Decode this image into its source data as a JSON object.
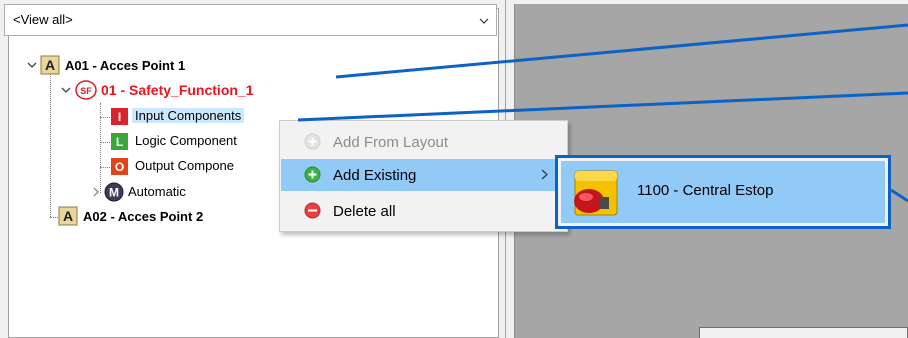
{
  "view_selector": {
    "value": "<View all>"
  },
  "tree": {
    "access_point_1": {
      "badge": "A",
      "label": "A01 - Acces Point 1"
    },
    "safety_function": {
      "badge": "SF",
      "label": "01 - Safety_Function_1"
    },
    "input_components": {
      "badge": "I",
      "label": "Input Components"
    },
    "logic_components": {
      "badge": "L",
      "label": "Logic Component"
    },
    "output_components": {
      "badge": "O",
      "label": "Output Compone"
    },
    "automatic": {
      "badge": "M",
      "label": "Automatic"
    },
    "access_point_2": {
      "badge": "A",
      "label": "A02 - Acces Point 2"
    }
  },
  "context_menu": {
    "items": [
      {
        "label": "Add From Layout",
        "icon": "add-icon",
        "enabled": false
      },
      {
        "label": "Add Existing",
        "icon": "add-icon",
        "enabled": true,
        "has_submenu": true
      },
      {
        "label": "Delete all",
        "icon": "remove-icon",
        "enabled": true
      }
    ]
  },
  "submenu": {
    "items": [
      {
        "label": "1100 - Central Estop",
        "icon": "emergency-stop-icon"
      }
    ]
  },
  "colors": {
    "safety_function_text": "#e8141e",
    "menu_highlight": "#91c9f7",
    "callout_blue": "#0b63c5",
    "workspace_gray": "#a6a6a6"
  }
}
